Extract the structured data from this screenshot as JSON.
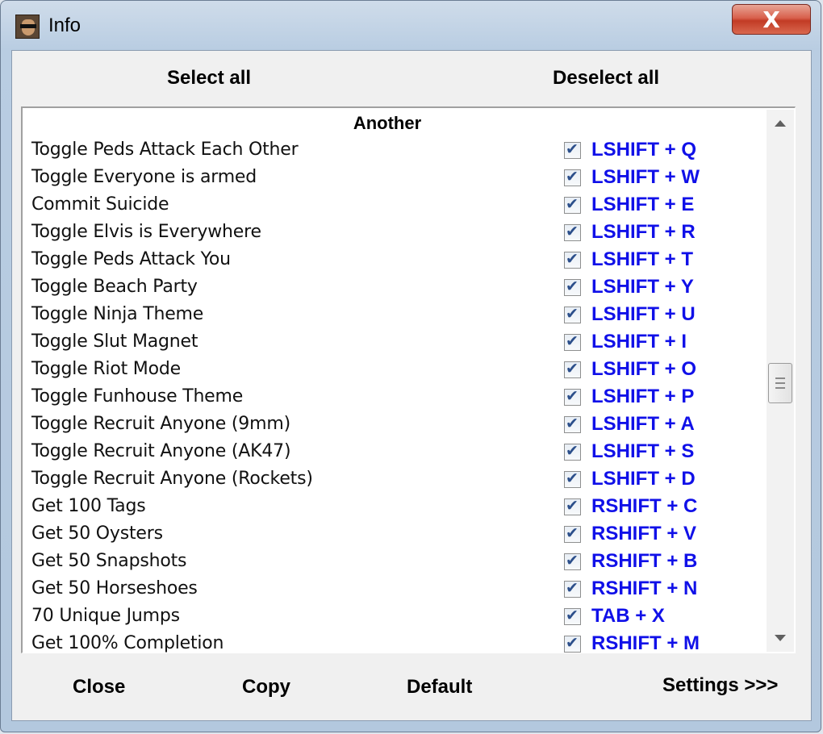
{
  "window": {
    "title": "Info",
    "close_label": "X"
  },
  "toolbar": {
    "select_all": "Select all",
    "deselect_all": "Deselect all"
  },
  "list": {
    "section_title": "Another",
    "items": [
      {
        "name": "Toggle Peds Attack Each Other",
        "checked": true,
        "hotkey": "LSHIFT + Q"
      },
      {
        "name": "Toggle Everyone is armed",
        "checked": true,
        "hotkey": "LSHIFT + W"
      },
      {
        "name": "Commit Suicide",
        "checked": true,
        "hotkey": "LSHIFT + E"
      },
      {
        "name": "Toggle Elvis is Everywhere",
        "checked": true,
        "hotkey": "LSHIFT + R"
      },
      {
        "name": "Toggle Peds Attack You",
        "checked": true,
        "hotkey": "LSHIFT + T"
      },
      {
        "name": "Toggle Beach Party",
        "checked": true,
        "hotkey": "LSHIFT + Y"
      },
      {
        "name": "Toggle Ninja Theme",
        "checked": true,
        "hotkey": "LSHIFT + U"
      },
      {
        "name": "Toggle Slut Magnet",
        "checked": true,
        "hotkey": "LSHIFT + I"
      },
      {
        "name": "Toggle Riot Mode",
        "checked": true,
        "hotkey": "LSHIFT + O"
      },
      {
        "name": "Toggle Funhouse Theme",
        "checked": true,
        "hotkey": "LSHIFT + P"
      },
      {
        "name": "Toggle Recruit Anyone (9mm)",
        "checked": true,
        "hotkey": "LSHIFT + A"
      },
      {
        "name": "Toggle Recruit Anyone (AK47)",
        "checked": true,
        "hotkey": "LSHIFT + S"
      },
      {
        "name": "Toggle Recruit Anyone (Rockets)",
        "checked": true,
        "hotkey": "LSHIFT + D"
      },
      {
        "name": "Get 100 Tags",
        "checked": true,
        "hotkey": "RSHIFT + C"
      },
      {
        "name": "Get 50 Oysters",
        "checked": true,
        "hotkey": "RSHIFT + V"
      },
      {
        "name": "Get 50 Snapshots",
        "checked": true,
        "hotkey": "RSHIFT + B"
      },
      {
        "name": "Get 50 Horseshoes",
        "checked": true,
        "hotkey": "RSHIFT + N"
      },
      {
        "name": "70 Unique Jumps",
        "checked": true,
        "hotkey": "TAB + X"
      },
      {
        "name": "Get 100% Completion",
        "checked": true,
        "hotkey": "RSHIFT + M"
      }
    ]
  },
  "footer": {
    "close": "Close",
    "copy": "Copy",
    "default": "Default",
    "settings": "Settings >>>"
  }
}
